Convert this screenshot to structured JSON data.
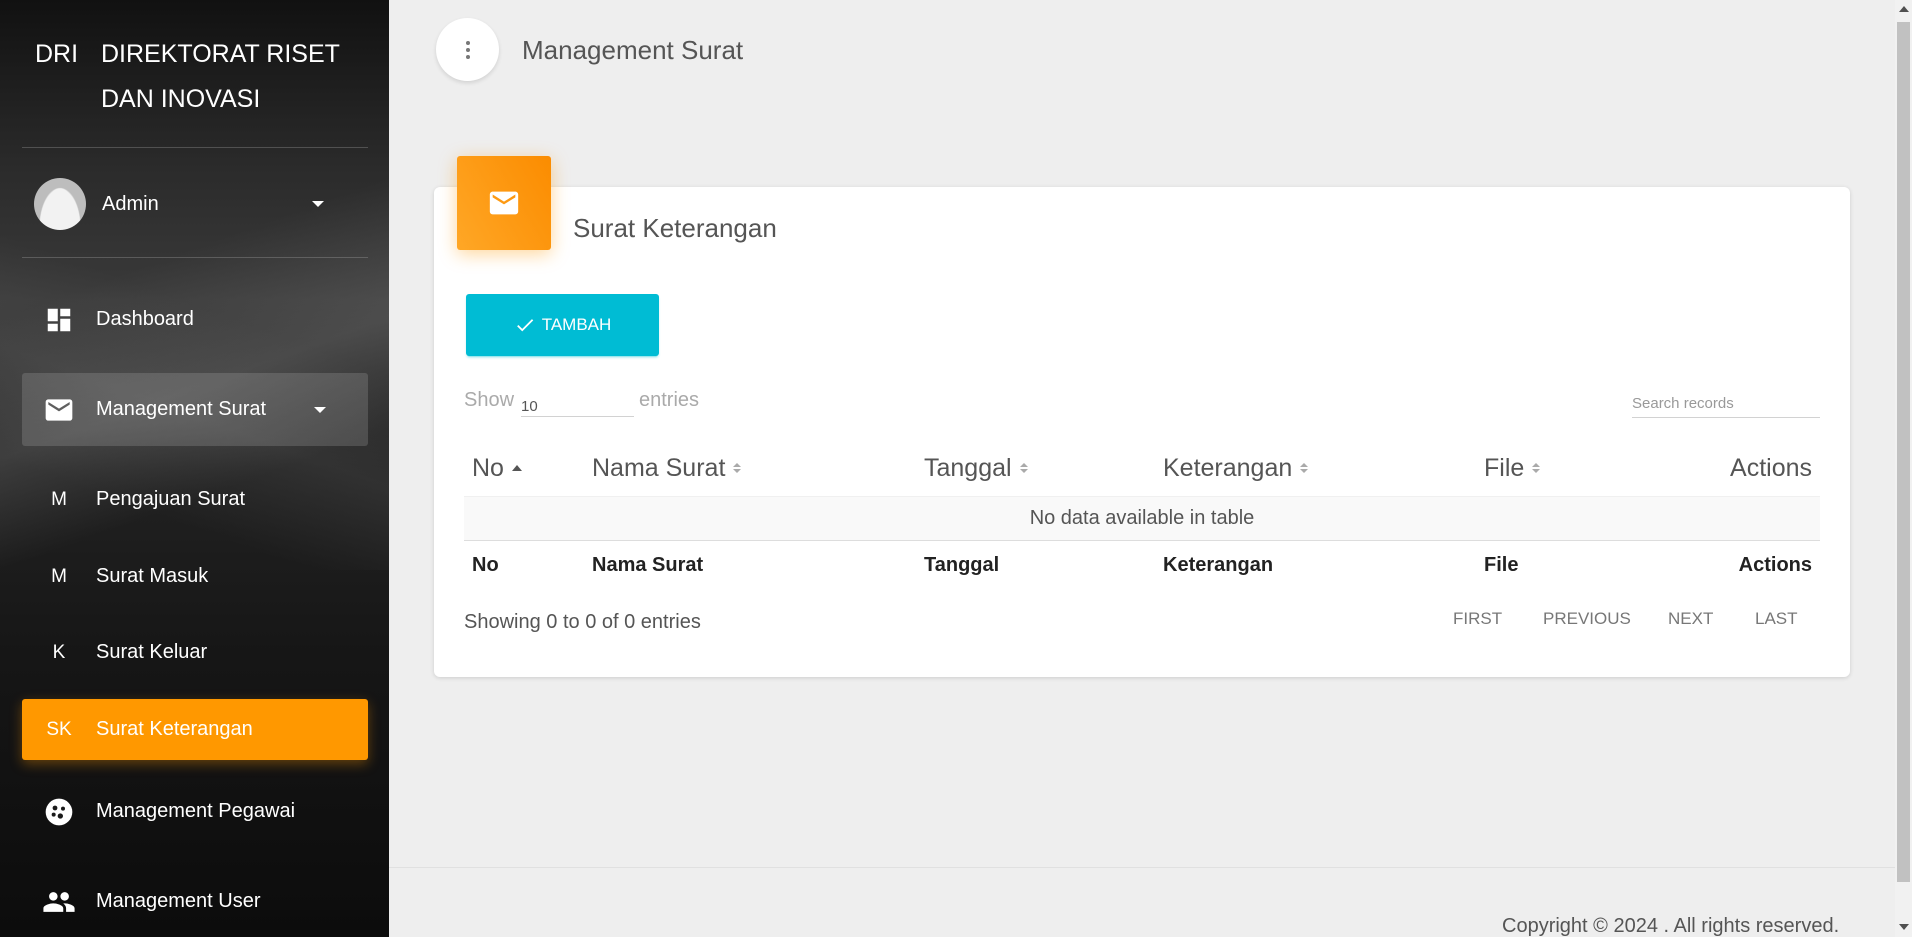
{
  "brand": {
    "mini": "DRI",
    "full": "DIREKTORAT RISET DAN INOVASI"
  },
  "user": {
    "name": "Admin"
  },
  "nav": {
    "dashboard": "Dashboard",
    "management_surat": "Management Surat",
    "sub": [
      {
        "mini": "M",
        "label": "Pengajuan Surat"
      },
      {
        "mini": "M",
        "label": "Surat Masuk"
      },
      {
        "mini": "K",
        "label": "Surat Keluar"
      },
      {
        "mini": "SK",
        "label": "Surat Keterangan"
      }
    ],
    "management_pegawai": "Management Pegawai",
    "management_user": "Management User"
  },
  "header": {
    "title": "Management Surat"
  },
  "card": {
    "title": "Surat Keterangan",
    "add_label": "TAMBAH",
    "show_label": "Show",
    "entries_value": "10",
    "entries_label": "entries",
    "search_placeholder": "Search records",
    "columns": [
      "No",
      "Nama Surat",
      "Tanggal",
      "Keterangan",
      "File",
      "Actions"
    ],
    "empty_message": "No data available in table",
    "info": "Showing 0 to 0 of 0 entries",
    "pager": [
      "FIRST",
      "PREVIOUS",
      "NEXT",
      "LAST"
    ]
  },
  "footer": {
    "copyright": "Copyright © 2024 . All rights reserved."
  },
  "colors": {
    "accent": "#ff9800",
    "button": "#00bcd4"
  }
}
